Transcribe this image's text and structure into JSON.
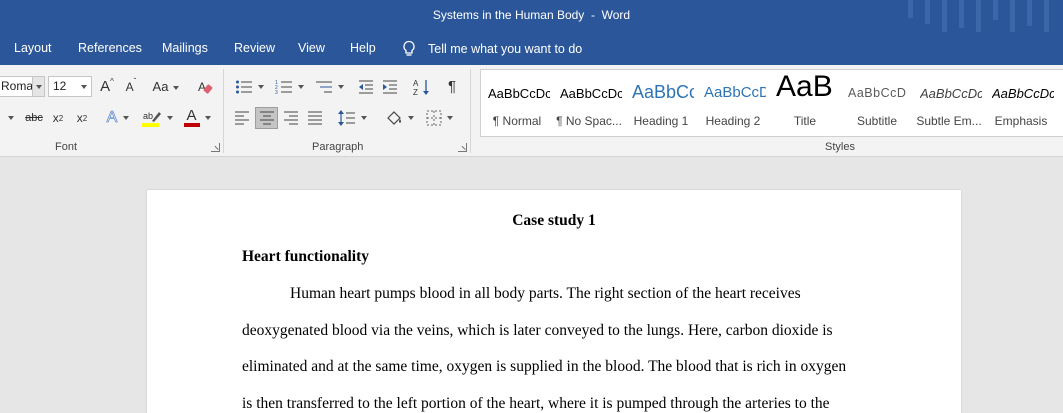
{
  "window": {
    "title": "Systems in the Human Body  -  Word"
  },
  "menu": {
    "tabs": [
      "Layout",
      "References",
      "Mailings",
      "Review",
      "View",
      "Help"
    ],
    "tell_me": "Tell me what you want to do"
  },
  "ribbon": {
    "font": {
      "name": "Roma",
      "size": "12",
      "grow_label": "A",
      "shrink_label": "A",
      "case_label": "Aa",
      "strike_label": "abc",
      "sub_label": "x",
      "sub_index": "2",
      "sup_label": "x",
      "sup_index": "2",
      "effects_label": "A",
      "color_label": "A",
      "group_label": "Font"
    },
    "paragraph": {
      "group_label": "Paragraph",
      "pilcrow": "¶"
    },
    "styles": {
      "group_label": "Styles",
      "items": [
        {
          "sample": "AaBbCcDc",
          "name": "¶ Normal"
        },
        {
          "sample": "AaBbCcDc",
          "name": "¶ No Spac..."
        },
        {
          "sample": "AaBbCc",
          "name": "Heading 1"
        },
        {
          "sample": "AaBbCcD",
          "name": "Heading 2"
        },
        {
          "sample": "AaB",
          "name": "Title"
        },
        {
          "sample": "AaBbCcD",
          "name": "Subtitle"
        },
        {
          "sample": "AaBbCcDc",
          "name": "Subtle Em..."
        },
        {
          "sample": "AaBbCcDc",
          "name": "Emphasis"
        }
      ]
    },
    "colors": {
      "highlight": "#ffff00",
      "font_color": "#c00000",
      "accent": "#2b579a"
    }
  },
  "document": {
    "title": "Case study 1",
    "heading": "Heart functionality",
    "lines": [
      "Human heart pumps blood in all body parts. The right section of the heart receives",
      "deoxygenated blood via the veins, which is later conveyed to the lungs. Here, carbon dioxide is",
      "eliminated and at the same time, oxygen is supplied in the blood. The blood that is rich in oxygen",
      "is then transferred to the left portion of the heart, where it is pumped through the arteries to the"
    ]
  }
}
